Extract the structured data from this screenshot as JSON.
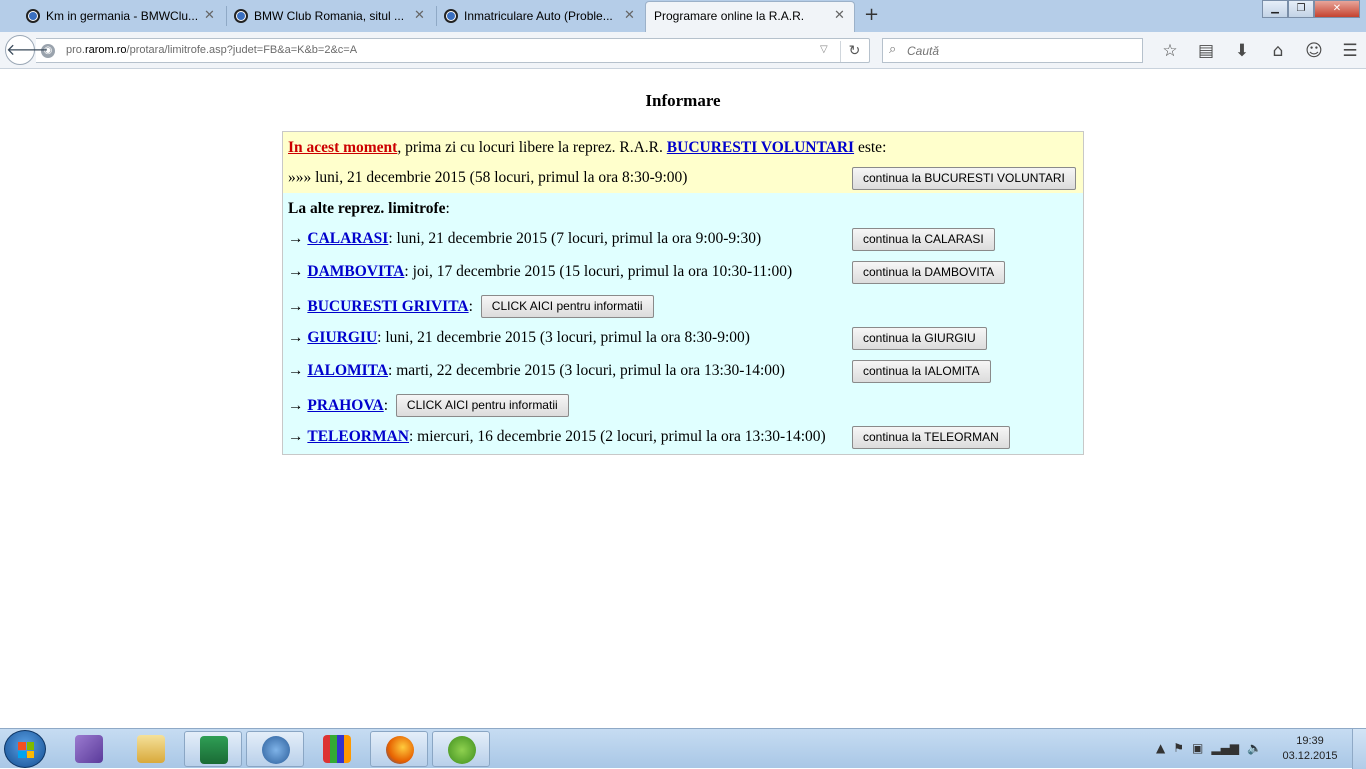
{
  "browser": {
    "tabs": [
      {
        "label": "Km in germania - BMWClu...",
        "close": "✕"
      },
      {
        "label": "BMW Club Romania, situl ...",
        "close": "✕"
      },
      {
        "label": "Inmatriculare Auto (Proble...",
        "close": "✕"
      },
      {
        "label": "Programare online la R.A.R.",
        "close": "✕",
        "active": true
      }
    ],
    "new_tab": "+",
    "url_prefix": "pro.",
    "url_domain": "rarom.ro",
    "url_path": "/protara/limitrofe.asp?judet=FB&a=K&b=2&c=A",
    "search_placeholder": "Caută",
    "icons": [
      "back-arrow-icon",
      "star-icon",
      "reading-list-icon",
      "download-icon",
      "home-icon",
      "hello-icon",
      "menu-icon"
    ]
  },
  "page": {
    "title": "Informare",
    "current": {
      "moment_link": "In acest moment",
      "text_before": ", prima zi cu locuri libere la reprez. R.A.R. ",
      "office_link": "BUCURESTI VOLUNTARI",
      "text_after": " este:",
      "date_line": "»»» luni, 21 decembrie 2015 (58 locuri, primul la ora 8:30-9:00)",
      "button": "continua la BUCURESTI VOLUNTARI"
    },
    "others_heading": "La alte reprez. limitrofe",
    "others_colon": ":",
    "arrow": "→ ",
    "others": [
      {
        "name": "CALARASI",
        "text": ": luni, 21 decembrie 2015 (7 locuri, primul la ora 9:00-9:30)",
        "button": "continua la CALARASI"
      },
      {
        "name": "DAMBOVITA",
        "text": ": joi, 17 decembrie 2015 (15 locuri, primul la ora 10:30-11:00)",
        "button": "continua la DAMBOVITA"
      },
      {
        "name": "BUCURESTI GRIVITA",
        "text": ":",
        "button": "CLICK AICI pentru informatii"
      },
      {
        "name": "GIURGIU",
        "text": ": luni, 21 decembrie 2015 (3 locuri, primul la ora 8:30-9:00)",
        "button": "continua la GIURGIU"
      },
      {
        "name": "IALOMITA",
        "text": ": marti, 22 decembrie 2015 (3 locuri, primul la ora 13:30-14:00)",
        "button": "continua la IALOMITA"
      },
      {
        "name": "PRAHOVA",
        "text": ":",
        "button": "CLICK AICI pentru informatii"
      },
      {
        "name": "TELEORMAN",
        "text": ": miercuri, 16 decembrie 2015 (2 locuri, primul la ora 13:30-14:00)",
        "button": "continua la TELEORMAN"
      }
    ]
  },
  "taskbar": {
    "time": "19:39",
    "date": "03.12.2015",
    "apps": [
      "visual-studio-icon",
      "file-explorer-icon",
      "excel-icon",
      "thunderbird-icon",
      "chart-app-icon",
      "firefox-icon",
      "utorrent-icon"
    ]
  },
  "colors": {
    "yellow_bg": "#ffffcc",
    "cyan_bg": "#e0ffff",
    "link_blue": "#0000cc",
    "link_red": "#cc0000"
  }
}
